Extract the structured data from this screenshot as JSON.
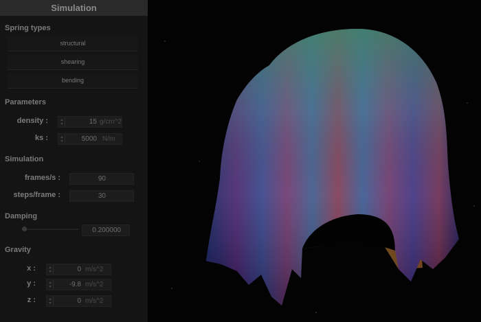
{
  "panel": {
    "title": "Simulation",
    "spring_types": {
      "label": "Spring types",
      "buttons": [
        "structural",
        "shearing",
        "bending"
      ]
    },
    "parameters": {
      "label": "Parameters",
      "density": {
        "label": "density :",
        "value": "15",
        "unit": "g/cm^2"
      },
      "ks": {
        "label": "ks :",
        "value": "5000",
        "unit": "N/m"
      }
    },
    "simulation": {
      "label": "Simulation",
      "fps": {
        "label": "frames/s :",
        "value": "90"
      },
      "steps": {
        "label": "steps/frame :",
        "value": "30"
      }
    },
    "damping": {
      "label": "Damping",
      "value": "0.200000",
      "level": 0.2
    },
    "gravity": {
      "label": "Gravity",
      "x": {
        "label": "x :",
        "value": "0",
        "unit": "m/s^2"
      },
      "y": {
        "label": "y :",
        "value": "-9.8",
        "unit": "m/s^2"
      },
      "z": {
        "label": "z :",
        "value": "0",
        "unit": "m/s^2"
      }
    }
  }
}
